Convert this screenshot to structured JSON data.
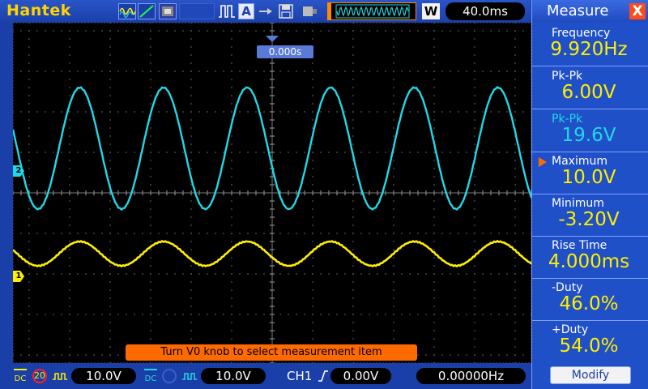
{
  "app": {
    "brand": "Hantek"
  },
  "toolbar": {
    "auto_label": "A",
    "memory_depth_label": "",
    "waveform_mode": "W",
    "timebase": "40.0ms"
  },
  "screen": {
    "trigger_position": "0.000s",
    "hint": "Turn V0 knob to select measurement item",
    "ch1_marker": "1",
    "ch2_marker": "2"
  },
  "traces": {
    "ch2": {
      "color": "#22d8e6",
      "cycles": 6.2,
      "amplitude_divs": 1.5,
      "offset_divs": 1.1,
      "phase": 0.55
    },
    "ch1": {
      "color": "#ffee00",
      "cycles": 6.2,
      "amplitude_divs": 0.3,
      "offset_divs": -1.5,
      "phase": 0.55
    }
  },
  "measure": {
    "title": "Measure",
    "close": "X",
    "items": [
      {
        "label": "Frequency",
        "value": "9.920Hz",
        "color": "yellow"
      },
      {
        "label": "Pk-Pk",
        "value": "6.00V",
        "color": "yellow"
      },
      {
        "label": "Pk-Pk",
        "value": "19.6V",
        "color": "cyan"
      },
      {
        "label": "Maximum",
        "value": "10.0V",
        "color": "yellow",
        "selected": true
      },
      {
        "label": "Minimum",
        "value": "-3.20V",
        "color": "yellow"
      },
      {
        "label": "Rise Time",
        "value": "4.000ms",
        "color": "yellow"
      },
      {
        "label": "-Duty",
        "value": "46.0%",
        "color": "yellow"
      },
      {
        "label": "+Duty",
        "value": "54.0%",
        "color": "yellow"
      }
    ],
    "modify": "Modify"
  },
  "status": {
    "ch1_coupling": "DC",
    "ch1_bandwidth": "20",
    "ch1_volts": "10.0V",
    "ch2_coupling": "DC",
    "ch2_volts": "10.0V",
    "trigger_source": "CH1",
    "trigger_level": "0.00V",
    "trigger_frequency": "0.00000Hz"
  }
}
